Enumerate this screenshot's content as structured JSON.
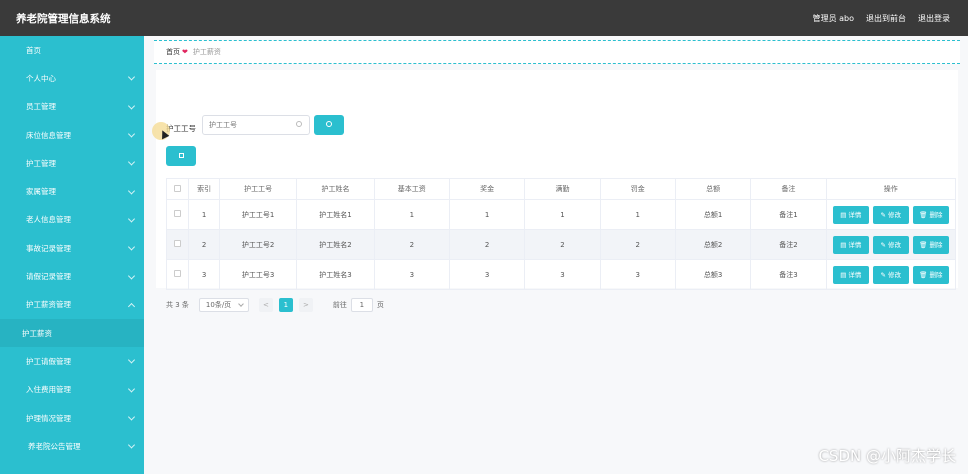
{
  "topbar": {
    "title": "养老院管理信息系统",
    "user": "管理员 abo",
    "back_front": "退出到前台",
    "logout": "退出登录"
  },
  "sidebar": {
    "items": [
      {
        "label": "首页"
      },
      {
        "label": "个人中心"
      },
      {
        "label": "员工管理"
      },
      {
        "label": "床位信息管理"
      },
      {
        "label": "护工管理"
      },
      {
        "label": "家属管理"
      },
      {
        "label": "老人信息管理"
      },
      {
        "label": "事故记录管理"
      },
      {
        "label": "请假记录管理"
      },
      {
        "label": "护工薪资管理"
      },
      {
        "label": "护工薪资"
      },
      {
        "label": "护工请假管理"
      },
      {
        "label": "入住费用管理"
      },
      {
        "label": "护理情况管理"
      },
      {
        "label": "养老院公告管理"
      }
    ]
  },
  "breadcrumb": {
    "home": "首页",
    "heart": "❤",
    "current": "护工薪资"
  },
  "search": {
    "label": "护工工号",
    "placeholder": "护工工号"
  },
  "table": {
    "headers": [
      "索引",
      "护工工号",
      "护工姓名",
      "基本工资",
      "奖金",
      "满勤",
      "罚金",
      "总额",
      "备注",
      "操作"
    ],
    "rows": [
      {
        "idx": "1",
        "no": "护工工号1",
        "name": "护工姓名1",
        "base": "1",
        "bonus": "1",
        "full": "1",
        "fine": "1",
        "total": "总额1",
        "note": "备注1"
      },
      {
        "idx": "2",
        "no": "护工工号2",
        "name": "护工姓名2",
        "base": "2",
        "bonus": "2",
        "full": "2",
        "fine": "2",
        "total": "总额2",
        "note": "备注2"
      },
      {
        "idx": "3",
        "no": "护工工号3",
        "name": "护工姓名3",
        "base": "3",
        "bonus": "3",
        "full": "3",
        "fine": "3",
        "total": "总额3",
        "note": "备注3"
      }
    ],
    "actions": {
      "detail": "详情",
      "edit": "修改",
      "delete": "删除"
    }
  },
  "pager": {
    "total": "共 3 条",
    "page_size": "10条/页",
    "prev": "<",
    "current": "1",
    "next": ">",
    "goto_label": "前往",
    "goto_value": "1",
    "page_unit": "页"
  },
  "watermark": "CSDN @小阿杰学长",
  "colors": {
    "accent": "#2bbfcf",
    "topbar": "#3a3a3a",
    "heart": "#e0245e"
  }
}
